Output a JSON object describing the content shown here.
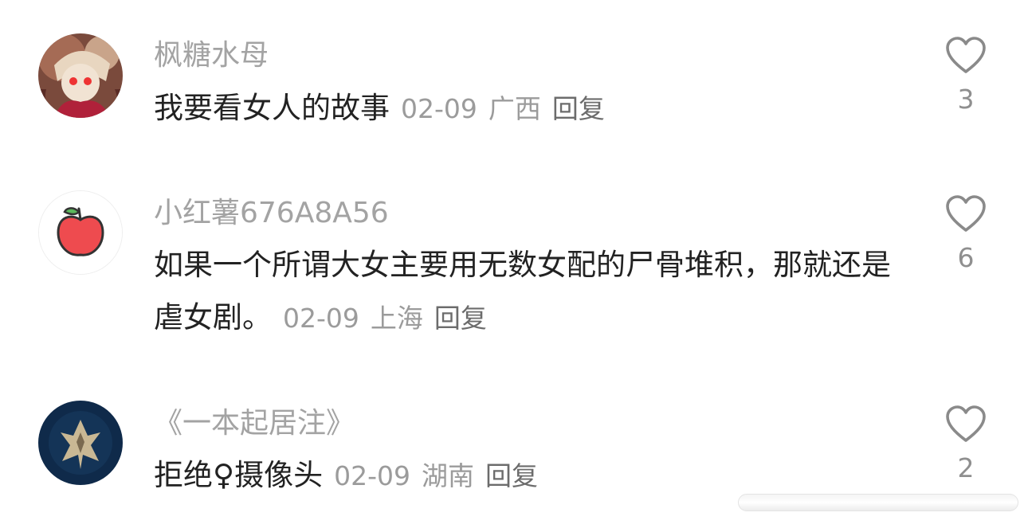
{
  "comments": [
    {
      "username": "枫糖水母",
      "text": "我要看女人的故事",
      "date": "02-09",
      "location": "广西",
      "reply_label": "回复",
      "likes": "3",
      "avatar": "anime-character-avatar"
    },
    {
      "username": "小红薯676A8A56",
      "text": "如果一个所谓大女主要用无数女配的尸骨堆积，那就还是虐女剧。",
      "date": "02-09",
      "location": "上海",
      "reply_label": "回复",
      "likes": "6",
      "avatar": "apple-avatar"
    },
    {
      "username": "《一本起居注》",
      "text": "拒绝♀摄像头",
      "date": "02-09",
      "location": "湖南",
      "reply_label": "回复",
      "likes": "2",
      "avatar": "dark-emblem-avatar"
    }
  ],
  "colors": {
    "username": "#a3a3a3",
    "text": "#222222",
    "meta": "#9b9b9b",
    "heart_outline": "#8a8a8a"
  }
}
